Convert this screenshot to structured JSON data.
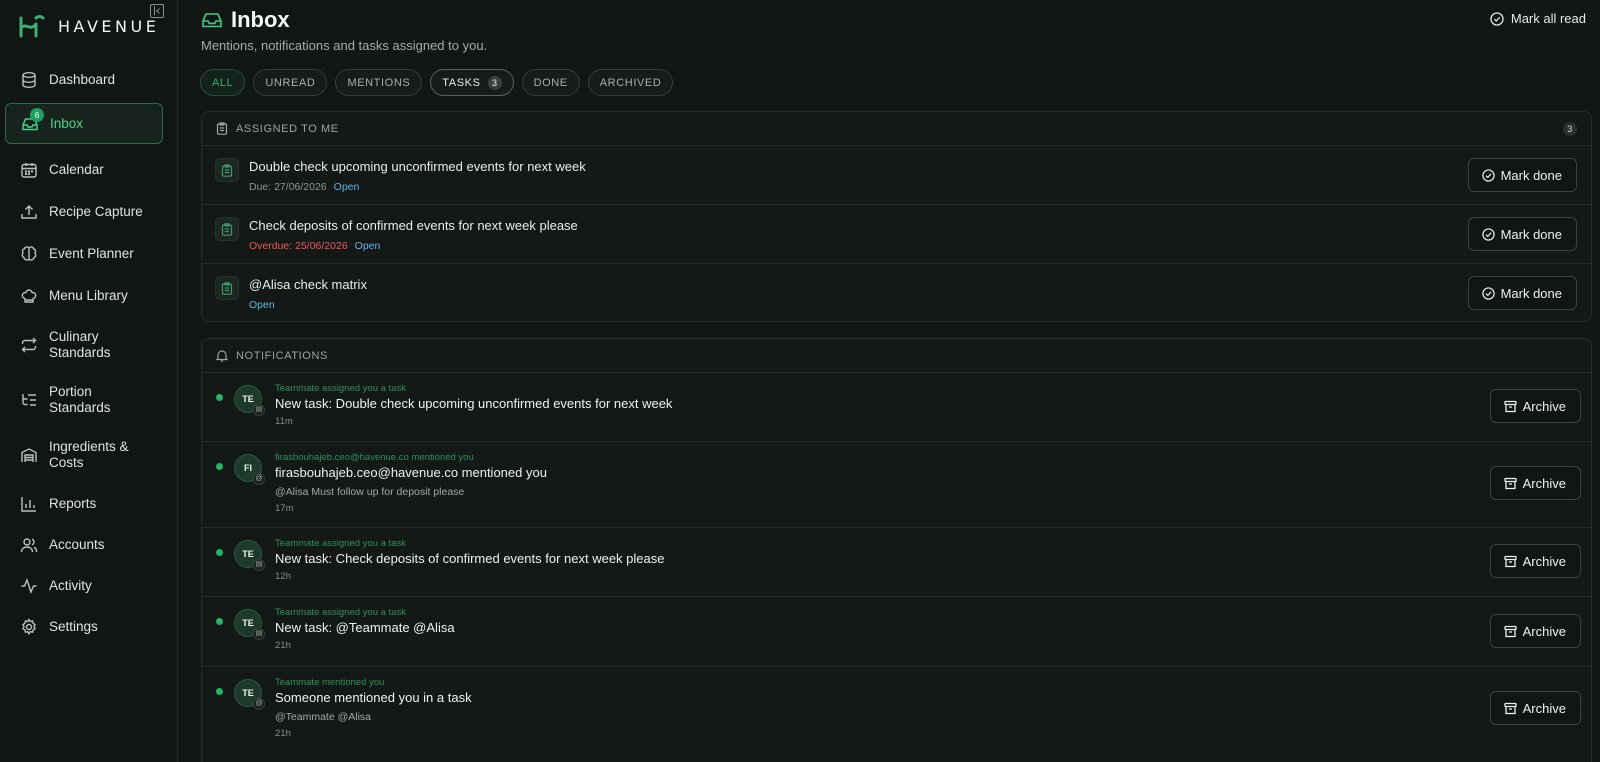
{
  "brand": {
    "name": "HAVENUE"
  },
  "sidebar": {
    "items": [
      {
        "label": "Dashboard",
        "icon": "database-icon"
      },
      {
        "label": "Inbox",
        "icon": "inbox-icon",
        "badge": "6",
        "active": true
      },
      {
        "label": "Calendar",
        "icon": "calendar-icon"
      },
      {
        "label": "Recipe Capture",
        "icon": "upload-icon"
      },
      {
        "label": "Event Planner",
        "icon": "brain-icon"
      },
      {
        "label": "Menu Library",
        "icon": "chef-hat-icon"
      },
      {
        "label": "Culinary Standards",
        "icon": "repeat-icon"
      },
      {
        "label": "Portion Standards",
        "icon": "list-tree-icon"
      },
      {
        "label": "Ingredients & Costs",
        "icon": "warehouse-icon"
      },
      {
        "label": "Reports",
        "icon": "bar-chart-icon"
      },
      {
        "label": "Accounts",
        "icon": "users-icon"
      },
      {
        "label": "Activity",
        "icon": "activity-icon"
      },
      {
        "label": "Settings",
        "icon": "gear-icon"
      }
    ]
  },
  "header": {
    "title": "Inbox",
    "subtitle": "Mentions, notifications and tasks assigned to you.",
    "mark_all_read": "Mark all read"
  },
  "tabs": [
    {
      "label": "ALL",
      "active": true
    },
    {
      "label": "UNREAD"
    },
    {
      "label": "MENTIONS"
    },
    {
      "label": "TASKS",
      "count": "3"
    },
    {
      "label": "DONE"
    },
    {
      "label": "ARCHIVED"
    }
  ],
  "assigned": {
    "heading": "ASSIGNED TO ME",
    "count": "3",
    "tasks": [
      {
        "title": "Double check upcoming unconfirmed events for next week",
        "due": "Due: 27/06/2026",
        "status": "Open"
      },
      {
        "title": "Check deposits of confirmed events for next week please",
        "due": "Overdue: 25/06/2026",
        "status": "Open"
      },
      {
        "title": "@Alisa check matrix",
        "due": "",
        "status": "Open"
      }
    ],
    "mark_done_label": "Mark done"
  },
  "notifications": {
    "heading": "NOTIFICATIONS",
    "archive_label": "Archive",
    "items": [
      {
        "initials": "TE",
        "kind": "Teammate assigned you a task",
        "title": "New task: Double check upcoming unconfirmed events for next week",
        "body": "",
        "time": "11m",
        "mini": "task"
      },
      {
        "initials": "FI",
        "kind": "firasbouhajeb.ceo@havenue.co mentioned you",
        "title": "firasbouhajeb.ceo@havenue.co mentioned you",
        "body": "@Alisa Must follow up for deposit please",
        "time": "17m",
        "mini": "mention"
      },
      {
        "initials": "TE",
        "kind": "Teammate assigned you a task",
        "title": "New task: Check deposits of confirmed events for next week please",
        "body": "",
        "time": "12h",
        "mini": "task"
      },
      {
        "initials": "TE",
        "kind": "Teammate assigned you a task",
        "title": "New task: @Teammate @Alisa",
        "body": "",
        "time": "21h",
        "mini": "task"
      },
      {
        "initials": "TE",
        "kind": "Teammate mentioned you",
        "title": "Someone mentioned you in a task",
        "body": "@Teammate @Alisa",
        "time": "21h",
        "mini": "mention"
      }
    ]
  },
  "colors": {
    "accent": "#22b566",
    "background": "#121615",
    "overdue": "#ef5757",
    "open_status": "#5fb6e8"
  }
}
